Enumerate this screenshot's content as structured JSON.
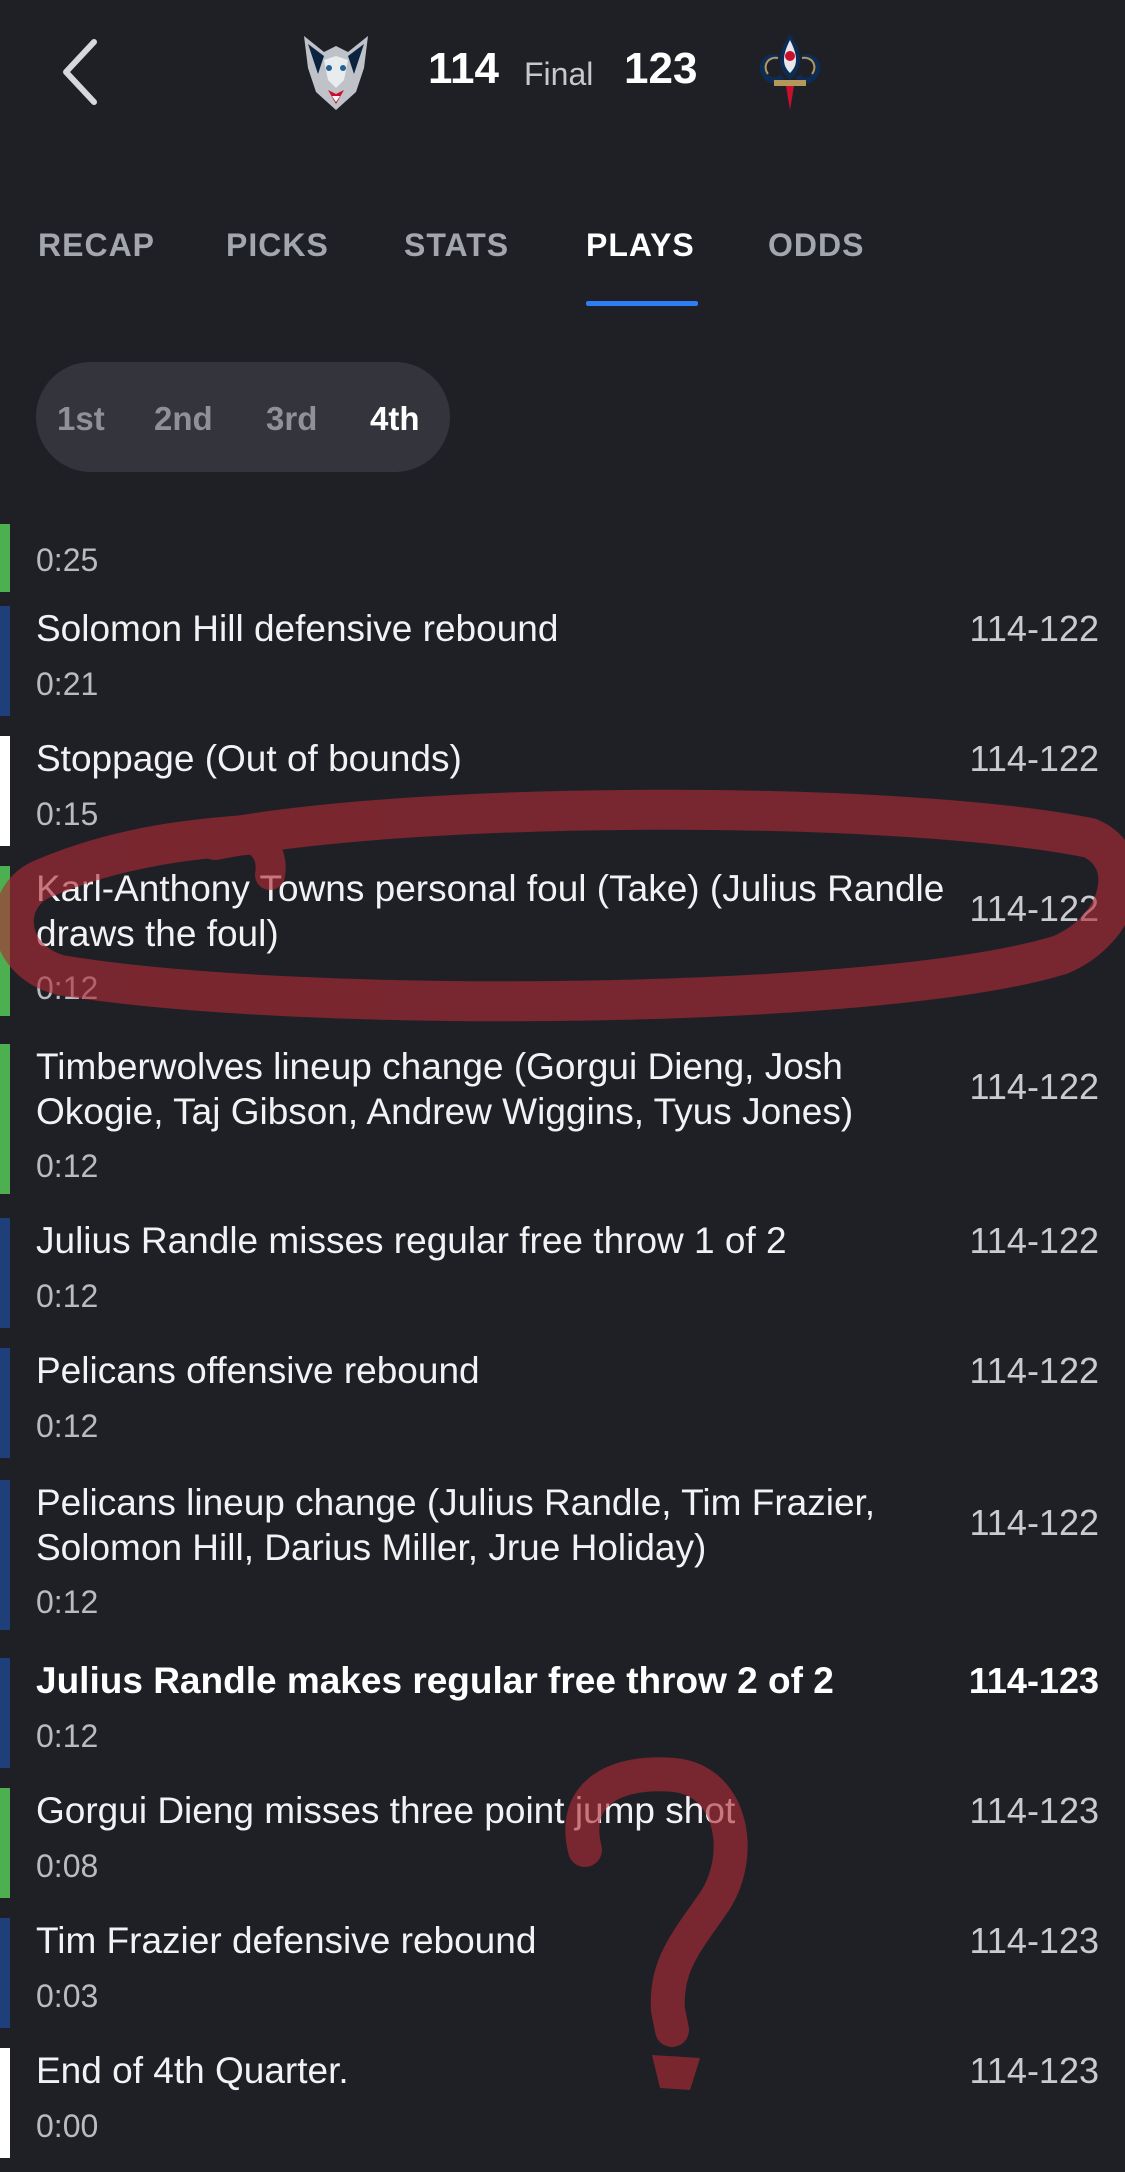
{
  "header": {
    "back_icon": "chevron-left-icon",
    "away_score": "114",
    "status": "Final",
    "home_score": "123",
    "away_logo": "timberwolves-logo",
    "home_logo": "pelicans-logo"
  },
  "tabs": [
    {
      "label": "RECAP"
    },
    {
      "label": "PICKS"
    },
    {
      "label": "STATS"
    },
    {
      "label": "PLAYS",
      "active": true
    },
    {
      "label": "ODDS"
    }
  ],
  "periods": [
    {
      "label": "1st"
    },
    {
      "label": "2nd"
    },
    {
      "label": "3rd"
    },
    {
      "label": "4th",
      "active": true
    }
  ],
  "plays": [
    {
      "desc": "",
      "time": "0:25",
      "score": "",
      "team": "wolves"
    },
    {
      "desc": "Solomon Hill defensive rebound",
      "time": "0:21",
      "score": "114-122",
      "team": "pels"
    },
    {
      "desc": "Stoppage (Out of bounds)",
      "time": "0:15",
      "score": "114-122",
      "team": "neutral"
    },
    {
      "desc": "Karl-Anthony Towns personal foul (Take) (Julius Randle draws the foul)",
      "time": "0:12",
      "score": "114-122",
      "team": "wolves"
    },
    {
      "desc": "Timberwolves lineup change (Gorgui Dieng, Josh Okogie, Taj Gibson, Andrew Wiggins, Tyus Jones)",
      "time": "0:12",
      "score": "114-122",
      "team": "wolves"
    },
    {
      "desc": "Julius Randle misses regular free throw 1 of 2",
      "time": "0:12",
      "score": "114-122",
      "team": "pels"
    },
    {
      "desc": "Pelicans offensive rebound",
      "time": "0:12",
      "score": "114-122",
      "team": "pels"
    },
    {
      "desc": "Pelicans lineup change (Julius Randle, Tim Frazier, Solomon Hill, Darius Miller, Jrue Holiday)",
      "time": "0:12",
      "score": "114-122",
      "team": "pels"
    },
    {
      "desc": "Julius Randle makes regular free throw 2 of 2",
      "time": "0:12",
      "score": "114-123",
      "team": "pels",
      "scoring": true
    },
    {
      "desc": "Gorgui Dieng misses three point jump shot",
      "time": "0:08",
      "score": "114-123",
      "team": "wolves"
    },
    {
      "desc": "Tim Frazier defensive rebound",
      "time": "0:03",
      "score": "114-123",
      "team": "pels"
    },
    {
      "desc": "End of 4th Quarter.",
      "time": "0:00",
      "score": "114-123",
      "team": "neutral"
    }
  ],
  "colors": {
    "background": "#1f2026",
    "accent": "#2f7df6",
    "wolves": "#4caf50",
    "pelicans": "#1f3f7a",
    "annotation": "#b02a36"
  }
}
